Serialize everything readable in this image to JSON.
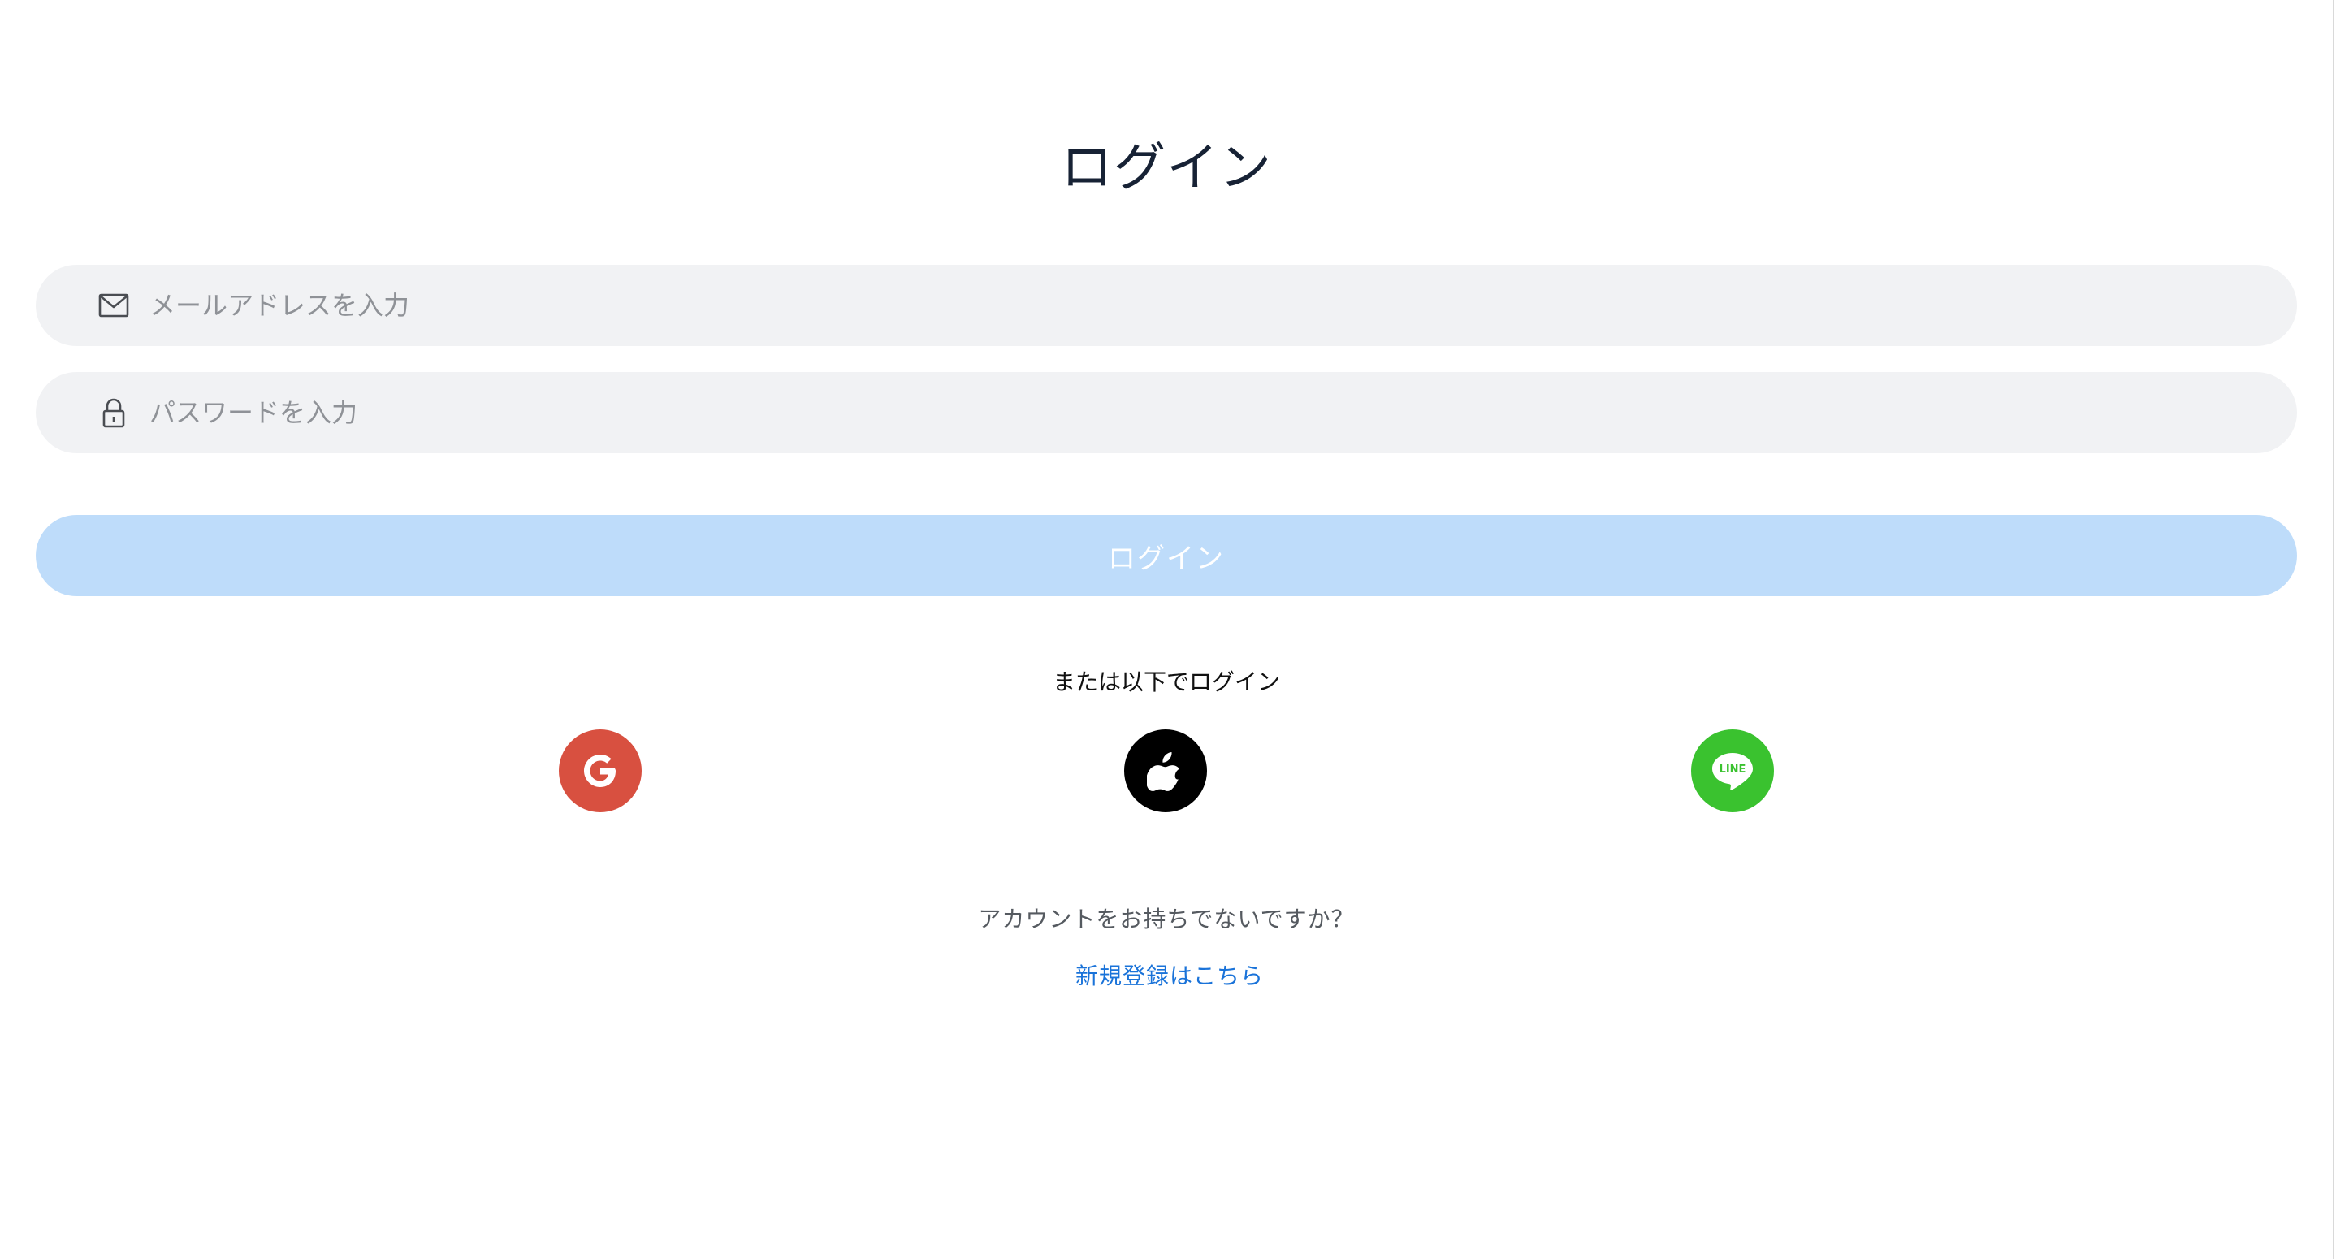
{
  "header": {
    "title": "ログイン"
  },
  "form": {
    "email": {
      "icon": "mail-icon",
      "value": "",
      "placeholder": "メールアドレスを入力"
    },
    "password": {
      "icon": "lock-icon",
      "value": "",
      "placeholder": "パスワードを入力"
    },
    "submit_label": "ログイン"
  },
  "social": {
    "divider_text": "または以下でログイン",
    "providers": [
      {
        "name": "google",
        "icon": "google-icon",
        "color": "#d85040"
      },
      {
        "name": "apple",
        "icon": "apple-icon",
        "color": "#000000"
      },
      {
        "name": "line",
        "icon": "line-icon",
        "icon_text": "LINE",
        "color": "#3ac22f"
      }
    ]
  },
  "footer": {
    "question": "アカウントをお持ちでないですか？",
    "signup_link": "新規登録はこちら"
  },
  "colors": {
    "title": "#172235",
    "field_background": "#f1f2f4",
    "button_disabled": "#bedcfa",
    "link": "#1a73d9"
  }
}
